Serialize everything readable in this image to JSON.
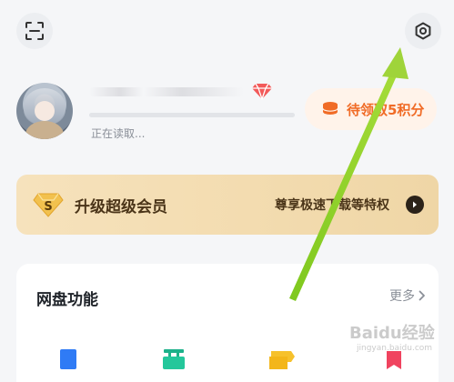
{
  "header": {
    "scan_icon": "scan-icon",
    "settings_icon": "settings-gear-icon"
  },
  "profile": {
    "status_text": "正在读取...",
    "vip_icon": "red-diamond-icon",
    "points_button_label": "待领取5积分",
    "points_icon": "coin-stack-icon",
    "accent_color": "#f06b26"
  },
  "vip_banner": {
    "badge_letter": "S",
    "title": "升级超级会员",
    "subtitle": "尊享极速下载等特权",
    "arrow_icon": "chevron-right-icon"
  },
  "netdisk_panel": {
    "title": "网盘功能",
    "more_label": "更多",
    "icons": [
      "blue-doc-icon",
      "green-bag-icon",
      "yellow-tag-icon",
      "red-bookmark-icon"
    ]
  },
  "overlay": {
    "annotation_arrow": "green-arrow-icon",
    "watermark_text": "Baidu经验",
    "watermark_sub": "jingyan.baidu.com"
  }
}
